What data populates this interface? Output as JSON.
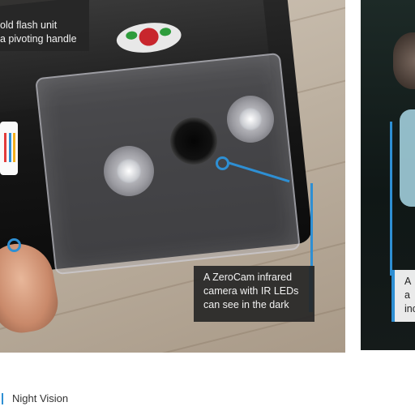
{
  "captions": {
    "top_left": [
      "old flash unit",
      "a pivoting handle"
    ],
    "zerocam": [
      "A ZeroCam infrared",
      "camera with IR LEDs",
      "can see in the dark"
    ],
    "side": [
      "A",
      "a",
      "inc"
    ]
  },
  "footer": {
    "section": "Night Vision"
  },
  "colors": {
    "accent": "#2e8fd3",
    "caption_bg": "#262626"
  }
}
